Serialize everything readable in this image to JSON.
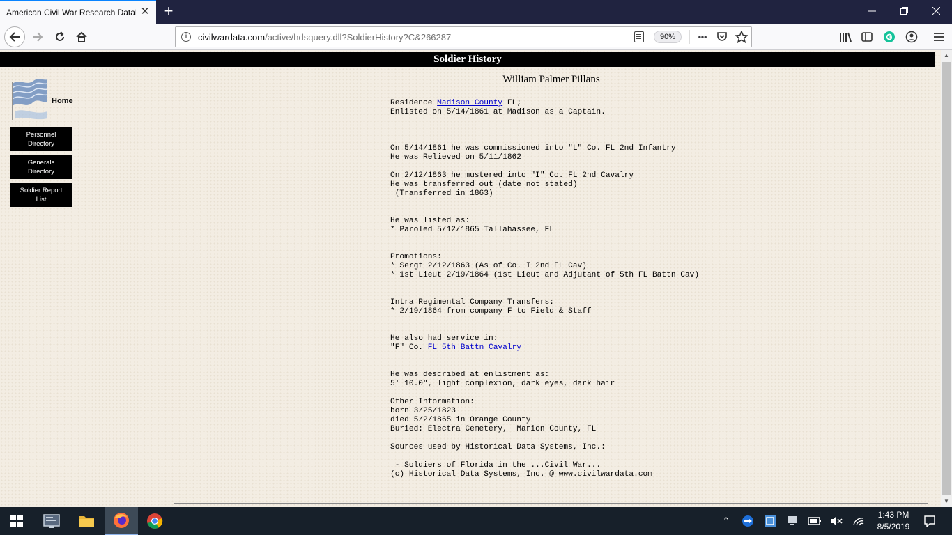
{
  "browser": {
    "tab_title": "American Civil War Research Database",
    "tab_close": "✕",
    "new_tab": "+",
    "url_domain": "civilwardata.com",
    "url_path": "/active/hdsquery.dll?SoldierHistory?C&266287",
    "zoom": "90%",
    "url_more": "•••"
  },
  "page": {
    "header_title": "Soldier History",
    "soldier_name": "William Palmer Pillans",
    "sidebar": {
      "home_label": "Home",
      "buttons": [
        "Personnel Directory",
        "Generals Directory",
        "Soldier Report List"
      ]
    },
    "record": {
      "residence_prefix": "Residence ",
      "residence_link": "Madison County",
      "residence_suffix": " FL;",
      "enlisted": "Enlisted on 5/14/1861 at Madison as a Captain.",
      "service1_line1": "On 5/14/1861 he was commissioned into \"L\" Co. FL 2nd Infantry",
      "service1_line2": "He was Relieved on 5/11/1862",
      "service2_line1": "On 2/12/1863 he mustered into \"I\" Co. FL 2nd Cavalry",
      "service2_line2": "He was transferred out (date not stated)",
      "service2_line3": " (Transferred in 1863)",
      "listed_header": "He was listed as:",
      "listed_item": "* Paroled 5/12/1865 Tallahassee, FL",
      "promotions_header": "Promotions:",
      "promotion1": "* Sergt 2/12/1863 (As of Co. I 2nd FL Cav)",
      "promotion2": "* 1st Lieut 2/19/1864 (1st Lieut and Adjutant of 5th FL Battn Cav)",
      "transfers_header": "Intra Regimental Company Transfers:",
      "transfer1": "* 2/19/1864 from company F to Field & Staff",
      "also_header": "He also had service in:",
      "also_prefix": "\"F\" Co. ",
      "also_link": "FL 5th Battn Cavalry ",
      "described_header": "He was described at enlistment as:",
      "description": "5' 10.0\", light complexion, dark eyes, dark hair",
      "other_header": "Other Information:",
      "born": "born 3/25/1823",
      "died": "died 5/2/1865 in Orange County",
      "buried": "Buried: Electra Cemetery,  Marion County, FL",
      "sources_header": "Sources used by Historical Data Systems, Inc.:",
      "source1": " - Soldiers of Florida in the ...Civil War...",
      "copyright": "(c) Historical Data Systems, Inc. @ www.civilwardata.com"
    }
  },
  "taskbar": {
    "time": "1:43 PM",
    "date": "8/5/2019"
  },
  "colors": {
    "tab_strip": "#202340",
    "toolbar": "#f9f9fb",
    "page_bg": "#f3ede3",
    "header_bar": "#000000",
    "link": "#0000cc",
    "taskbar": "#17202a"
  }
}
